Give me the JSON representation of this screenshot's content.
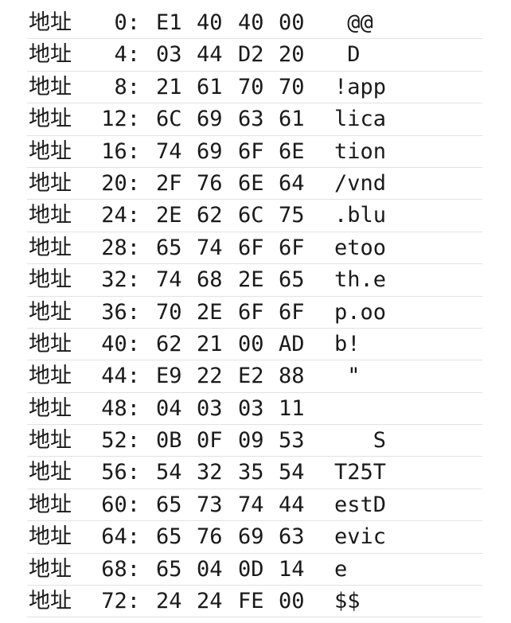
{
  "label": "地址",
  "rows": [
    {
      "addr": "0:",
      "bytes": [
        "E1",
        "40",
        "40",
        "00"
      ],
      "ascii": " @@"
    },
    {
      "addr": "4:",
      "bytes": [
        "03",
        "44",
        "D2",
        "20"
      ],
      "ascii": " D"
    },
    {
      "addr": "8:",
      "bytes": [
        "21",
        "61",
        "70",
        "70"
      ],
      "ascii": "!app"
    },
    {
      "addr": "12:",
      "bytes": [
        "6C",
        "69",
        "63",
        "61"
      ],
      "ascii": "lica"
    },
    {
      "addr": "16:",
      "bytes": [
        "74",
        "69",
        "6F",
        "6E"
      ],
      "ascii": "tion"
    },
    {
      "addr": "20:",
      "bytes": [
        "2F",
        "76",
        "6E",
        "64"
      ],
      "ascii": "/vnd"
    },
    {
      "addr": "24:",
      "bytes": [
        "2E",
        "62",
        "6C",
        "75"
      ],
      "ascii": ".blu"
    },
    {
      "addr": "28:",
      "bytes": [
        "65",
        "74",
        "6F",
        "6F"
      ],
      "ascii": "etoo"
    },
    {
      "addr": "32:",
      "bytes": [
        "74",
        "68",
        "2E",
        "65"
      ],
      "ascii": "th.e"
    },
    {
      "addr": "36:",
      "bytes": [
        "70",
        "2E",
        "6F",
        "6F"
      ],
      "ascii": "p.oo"
    },
    {
      "addr": "40:",
      "bytes": [
        "62",
        "21",
        "00",
        "AD"
      ],
      "ascii": "b!"
    },
    {
      "addr": "44:",
      "bytes": [
        "E9",
        "22",
        "E2",
        "88"
      ],
      "ascii": " \""
    },
    {
      "addr": "48:",
      "bytes": [
        "04",
        "03",
        "03",
        "11"
      ],
      "ascii": ""
    },
    {
      "addr": "52:",
      "bytes": [
        "0B",
        "0F",
        "09",
        "53"
      ],
      "ascii": "   S"
    },
    {
      "addr": "56:",
      "bytes": [
        "54",
        "32",
        "35",
        "54"
      ],
      "ascii": "T25T"
    },
    {
      "addr": "60:",
      "bytes": [
        "65",
        "73",
        "74",
        "44"
      ],
      "ascii": "estD"
    },
    {
      "addr": "64:",
      "bytes": [
        "65",
        "76",
        "69",
        "63"
      ],
      "ascii": "evic"
    },
    {
      "addr": "68:",
      "bytes": [
        "65",
        "04",
        "0D",
        "14"
      ],
      "ascii": "e"
    },
    {
      "addr": "72:",
      "bytes": [
        "24",
        "24",
        "FE",
        "00"
      ],
      "ascii": "$$"
    }
  ]
}
